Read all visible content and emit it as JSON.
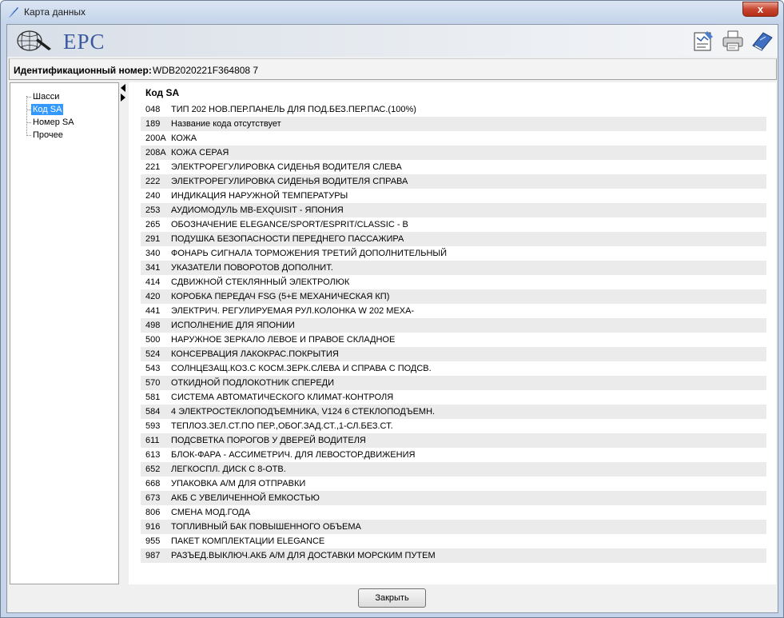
{
  "window": {
    "title": "Карта данных",
    "close_glyph": "x"
  },
  "header": {
    "logo_text": "EPC",
    "tools": [
      {
        "icon": "notes-icon"
      },
      {
        "icon": "print-icon"
      },
      {
        "icon": "help-book-icon"
      }
    ]
  },
  "ident": {
    "label": "Идентификационный номер:",
    "value": "WDB2020221F364808 7"
  },
  "tree": {
    "items": [
      {
        "label": "Шасси",
        "selected": false
      },
      {
        "label": "Код SA",
        "selected": true
      },
      {
        "label": "Номер SA",
        "selected": false
      },
      {
        "label": "Прочее",
        "selected": false
      }
    ]
  },
  "table": {
    "header": "Код SA",
    "rows": [
      {
        "code": "048",
        "desc": "ТИП 202 НОВ.ПЕР.ПАНЕЛЬ ДЛЯ ПОД.БЕЗ.ПЕР.ПАС.(100%)"
      },
      {
        "code": "189",
        "desc": "Название кода отсутствует"
      },
      {
        "code": "200A",
        "desc": "КОЖА"
      },
      {
        "code": "208A",
        "desc": "КОЖА СЕРАЯ"
      },
      {
        "code": "221",
        "desc": "ЭЛЕКТРОРЕГУЛИРОВКА СИДЕНЬЯ ВОДИТЕЛЯ СЛЕВА"
      },
      {
        "code": "222",
        "desc": "ЭЛЕКТРОРЕГУЛИРОВКА СИДЕНЬЯ ВОДИТЕЛЯ СПРАВА"
      },
      {
        "code": "240",
        "desc": "ИНДИКАЦИЯ НАРУЖНОЙ ТЕМПЕРАТУРЫ"
      },
      {
        "code": "253",
        "desc": "АУДИОМОДУЛЬ MB-EXQUISIT - ЯПОНИЯ"
      },
      {
        "code": "265",
        "desc": "ОБОЗНАЧЕНИЕ ELEGANCE/SPORT/ESPRIT/CLASSIC - B"
      },
      {
        "code": "291",
        "desc": "ПОДУШКА БЕЗОПАСНОСТИ ПЕРЕДНЕГО ПАССАЖИРА"
      },
      {
        "code": "340",
        "desc": "ФОНАРЬ СИГНАЛА ТОРМОЖЕНИЯ ТРЕТИЙ ДОПОЛНИТЕЛЬНЫЙ"
      },
      {
        "code": "341",
        "desc": "УКАЗАТЕЛИ ПОВОРОТОВ ДОПОЛНИТ."
      },
      {
        "code": "414",
        "desc": "СДВИЖНОЙ СТЕКЛЯННЫЙ ЭЛЕКТРОЛЮК"
      },
      {
        "code": "420",
        "desc": "КОРОБКА ПЕРЕДАЧ FSG (5+E МЕХАНИЧЕСКАЯ КП)"
      },
      {
        "code": "441",
        "desc": "ЭЛЕКТРИЧ. РЕГУЛИРУЕМАЯ РУЛ.КОЛОНКА W 202 МЕХА-"
      },
      {
        "code": "498",
        "desc": "ИСПОЛНЕНИЕ ДЛЯ ЯПОНИИ"
      },
      {
        "code": "500",
        "desc": "НАРУЖНОЕ ЗЕРКАЛО ЛЕВОЕ И ПРАВОЕ СКЛАДНОЕ"
      },
      {
        "code": "524",
        "desc": "КОНСЕРВАЦИЯ ЛАКОКРАС.ПОКРЫТИЯ"
      },
      {
        "code": "543",
        "desc": "СОЛНЦЕЗАЩ.КОЗ.С КОСМ.ЗЕРК.СЛЕВА И СПРАВА С ПОДСВ."
      },
      {
        "code": "570",
        "desc": "ОТКИДНОЙ ПОДЛОКОТНИК СПЕРЕДИ"
      },
      {
        "code": "581",
        "desc": "СИСТЕМА АВТОМАТИЧЕСКОГО КЛИМАТ-КОНТРОЛЯ"
      },
      {
        "code": "584",
        "desc": "4 ЭЛЕКТРОСТЕКЛОПОДЪЕМНИКА, V124 6 СТЕКЛОПОДЪЕМН."
      },
      {
        "code": "593",
        "desc": "ТЕПЛОЗ.ЗЕЛ.СТ.ПО ПЕР.,ОБОГ.ЗАД.СТ.,1-СЛ.БЕЗ.СТ."
      },
      {
        "code": "611",
        "desc": "ПОДСВЕТКА ПОРОГОВ У ДВЕРЕЙ ВОДИТЕЛЯ"
      },
      {
        "code": "613",
        "desc": "БЛОК-ФАРА - АССИМЕТРИЧ. ДЛЯ ЛЕВОСТОР.ДВИЖЕНИЯ"
      },
      {
        "code": "652",
        "desc": "ЛЕГКОСПЛ. ДИСК С 8-ОТВ."
      },
      {
        "code": "668",
        "desc": "УПАКОВКА А/М ДЛЯ ОТПРАВКИ"
      },
      {
        "code": "673",
        "desc": "АКБ С УВЕЛИЧЕННОЙ ЕМКОСТЬЮ"
      },
      {
        "code": "806",
        "desc": "СМЕНА МОД.ГОДА"
      },
      {
        "code": "916",
        "desc": "ТОПЛИВНЫЙ БАК ПОВЫШЕННОГО ОБЪЕМА"
      },
      {
        "code": "955",
        "desc": "ПАКЕТ КОМПЛЕКТАЦИИ ELEGANCE"
      },
      {
        "code": "987",
        "desc": "РАЗЪЕД.ВЫКЛЮЧ.АКБ А/М ДЛЯ ДОСТАВКИ МОРСКИМ ПУТЕМ"
      }
    ]
  },
  "footer": {
    "close_label": "Закрыть"
  },
  "colors": {
    "selection": "#3399ff",
    "logo_text": "#3a5aa0",
    "close_button": "#c8452f"
  }
}
